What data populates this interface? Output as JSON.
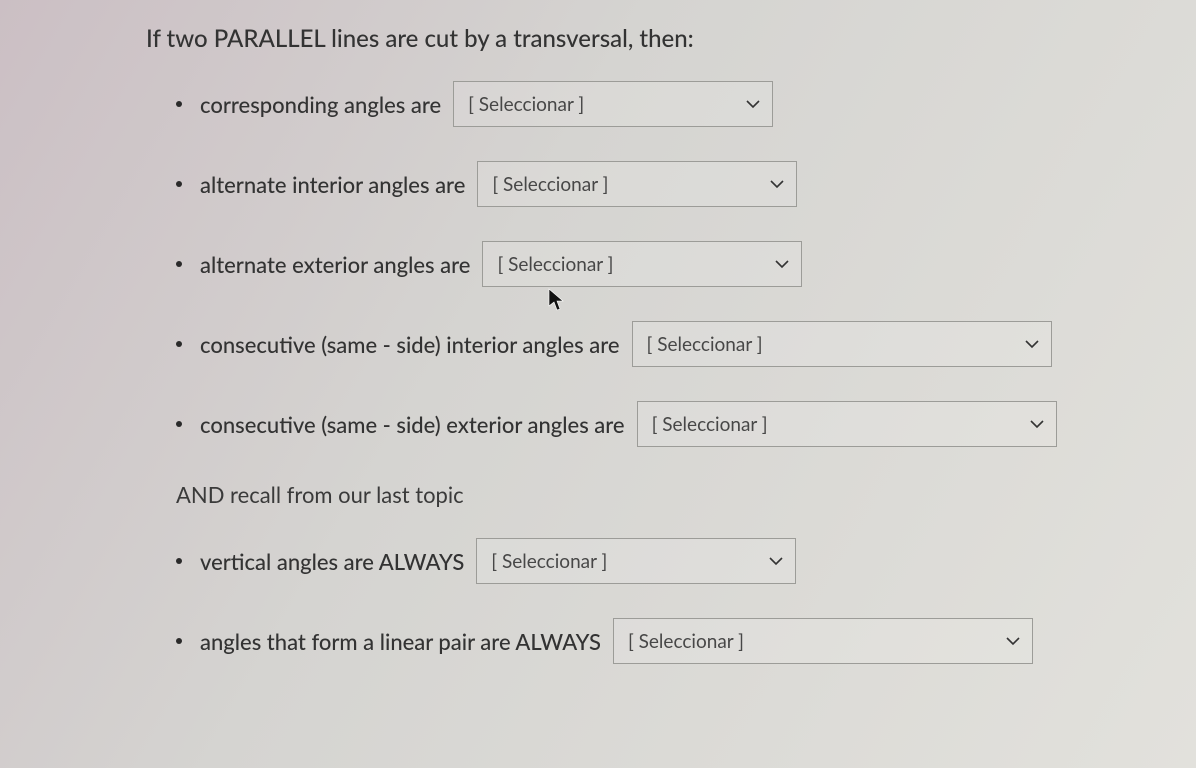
{
  "heading": "If two PARALLEL lines are cut by a transversal, then:",
  "select_placeholder": "[ Seleccionar ]",
  "items": [
    {
      "label": "corresponding angles are",
      "wide": false
    },
    {
      "label": "alternate interior angles are",
      "wide": false
    },
    {
      "label": "alternate exterior angles are",
      "wide": false
    },
    {
      "label": "consecutive (same - side) interior angles are",
      "wide": true
    },
    {
      "label": "consecutive (same - side) exterior angles are",
      "wide": true
    }
  ],
  "subheading": "AND recall from our last topic",
  "recall_items": [
    {
      "label": "vertical angles are ALWAYS",
      "wide": false
    },
    {
      "label": "angles that form a linear pair are ALWAYS",
      "wide": true
    }
  ]
}
